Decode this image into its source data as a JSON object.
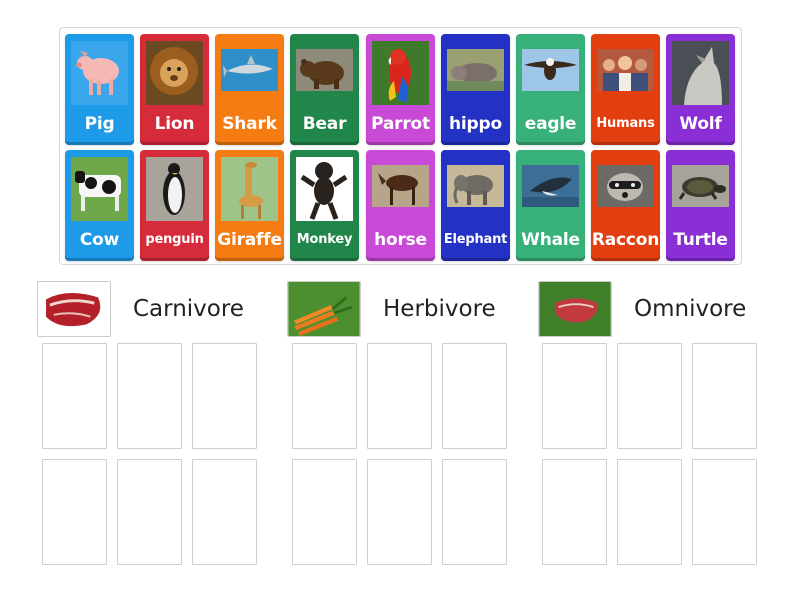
{
  "cards": [
    {
      "label": "Pig",
      "color": "#1e9be8",
      "icon": "pig-icon"
    },
    {
      "label": "Lion",
      "color": "#d62b3b",
      "icon": "lion-icon"
    },
    {
      "label": "Shark",
      "color": "#f57c12",
      "icon": "shark-icon"
    },
    {
      "label": "Bear",
      "color": "#20864a",
      "icon": "bear-icon"
    },
    {
      "label": "Parrot",
      "color": "#c94ad6",
      "icon": "parrot-icon"
    },
    {
      "label": "hippo",
      "color": "#2332c4",
      "icon": "hippo-icon"
    },
    {
      "label": "eagle",
      "color": "#38b07a",
      "icon": "eagle-icon"
    },
    {
      "label": "Humans",
      "color": "#e23f10",
      "icon": "humans-icon"
    },
    {
      "label": "Wolf",
      "color": "#8a2fd6",
      "icon": "wolf-icon"
    },
    {
      "label": "Cow",
      "color": "#1e9be8",
      "icon": "cow-icon"
    },
    {
      "label": "penguin",
      "color": "#d62b3b",
      "icon": "penguin-icon"
    },
    {
      "label": "Giraffe",
      "color": "#f57c12",
      "icon": "giraffe-icon"
    },
    {
      "label": "Monkey",
      "color": "#20864a",
      "icon": "monkey-icon"
    },
    {
      "label": "horse",
      "color": "#c94ad6",
      "icon": "horse-icon"
    },
    {
      "label": "Elephant",
      "color": "#2332c4",
      "icon": "elephant-icon"
    },
    {
      "label": "Whale",
      "color": "#38b07a",
      "icon": "whale-icon"
    },
    {
      "label": "Raccon",
      "color": "#e23f10",
      "icon": "raccoon-icon"
    },
    {
      "label": "Turtle",
      "color": "#8a2fd6",
      "icon": "turtle-icon"
    }
  ],
  "groups": [
    {
      "title": "Carnivore",
      "icon": "raw-meat-icon"
    },
    {
      "title": "Herbivore",
      "icon": "carrots-icon"
    },
    {
      "title": "Omnivore",
      "icon": "meat-on-grass-icon"
    }
  ]
}
